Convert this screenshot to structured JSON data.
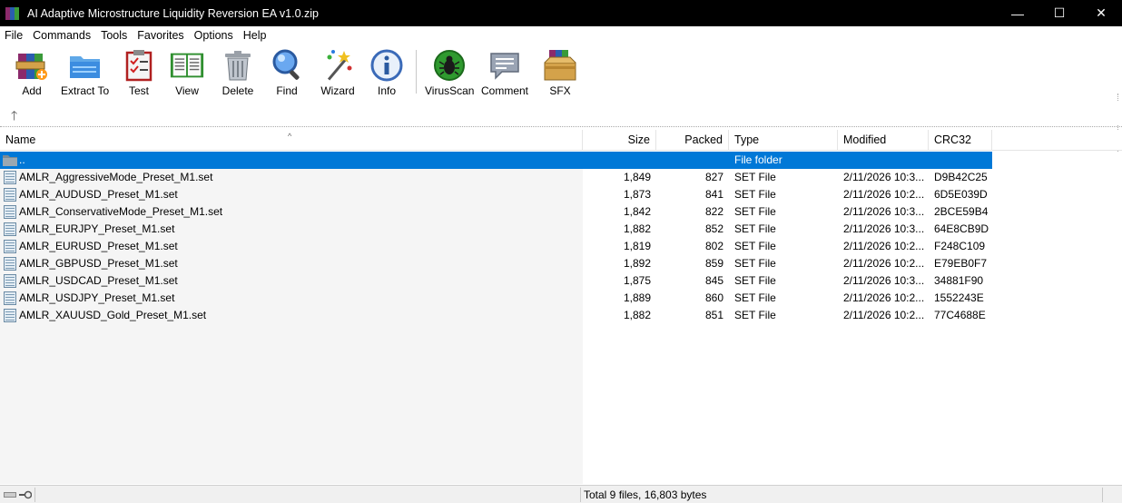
{
  "window": {
    "title": "AI Adaptive Microstructure Liquidity Reversion EA v1.0.zip",
    "minimize": "—",
    "maximize": "☐",
    "close": "✕"
  },
  "menu": [
    "File",
    "Commands",
    "Tools",
    "Favorites",
    "Options",
    "Help"
  ],
  "toolbar": {
    "buttons": [
      {
        "label": "Add",
        "icon": "add-books-icon"
      },
      {
        "label": "Extract To",
        "icon": "folder-icon"
      },
      {
        "label": "Test",
        "icon": "checklist-icon"
      },
      {
        "label": "View",
        "icon": "book-icon"
      },
      {
        "label": "Delete",
        "icon": "trash-icon"
      },
      {
        "label": "Find",
        "icon": "magnifier-icon"
      },
      {
        "label": "Wizard",
        "icon": "wand-icon"
      },
      {
        "label": "Info",
        "icon": "info-icon"
      },
      {
        "label": "VirusScan",
        "icon": "bug-icon"
      },
      {
        "label": "Comment",
        "icon": "comment-icon"
      },
      {
        "label": "SFX",
        "icon": "box-icon"
      }
    ],
    "up_arrow": "🡑"
  },
  "columns": {
    "name": "Name",
    "size": "Size",
    "packed": "Packed",
    "type": "Type",
    "modified": "Modified",
    "crc": "CRC32",
    "sort_indicator": "^"
  },
  "parent_row": {
    "name": "..",
    "type": "File folder"
  },
  "files": [
    {
      "name": "AMLR_AggressiveMode_Preset_M1.set",
      "size": "1,849",
      "packed": "827",
      "type": "SET File",
      "modified": "2/11/2026 10:3...",
      "crc": "D9B42C25"
    },
    {
      "name": "AMLR_AUDUSD_Preset_M1.set",
      "size": "1,873",
      "packed": "841",
      "type": "SET File",
      "modified": "2/11/2026 10:2...",
      "crc": "6D5E039D"
    },
    {
      "name": "AMLR_ConservativeMode_Preset_M1.set",
      "size": "1,842",
      "packed": "822",
      "type": "SET File",
      "modified": "2/11/2026 10:3...",
      "crc": "2BCE59B4"
    },
    {
      "name": "AMLR_EURJPY_Preset_M1.set",
      "size": "1,882",
      "packed": "852",
      "type": "SET File",
      "modified": "2/11/2026 10:3...",
      "crc": "64E8CB9D"
    },
    {
      "name": "AMLR_EURUSD_Preset_M1.set",
      "size": "1,819",
      "packed": "802",
      "type": "SET File",
      "modified": "2/11/2026 10:2...",
      "crc": "F248C109"
    },
    {
      "name": "AMLR_GBPUSD_Preset_M1.set",
      "size": "1,892",
      "packed": "859",
      "type": "SET File",
      "modified": "2/11/2026 10:2...",
      "crc": "E79EB0F7"
    },
    {
      "name": "AMLR_USDCAD_Preset_M1.set",
      "size": "1,875",
      "packed": "845",
      "type": "SET File",
      "modified": "2/11/2026 10:3...",
      "crc": "34881F90"
    },
    {
      "name": "AMLR_USDJPY_Preset_M1.set",
      "size": "1,889",
      "packed": "860",
      "type": "SET File",
      "modified": "2/11/2026 10:2...",
      "crc": "1552243E"
    },
    {
      "name": "AMLR_XAUUSD_Gold_Preset_M1.set",
      "size": "1,882",
      "packed": "851",
      "type": "SET File",
      "modified": "2/11/2026 10:2...",
      "crc": "77C4688E"
    }
  ],
  "status": {
    "total": "Total 9 files, 16,803 bytes"
  },
  "colors": {
    "selection": "#0078d7",
    "titlebar": "#000000"
  }
}
